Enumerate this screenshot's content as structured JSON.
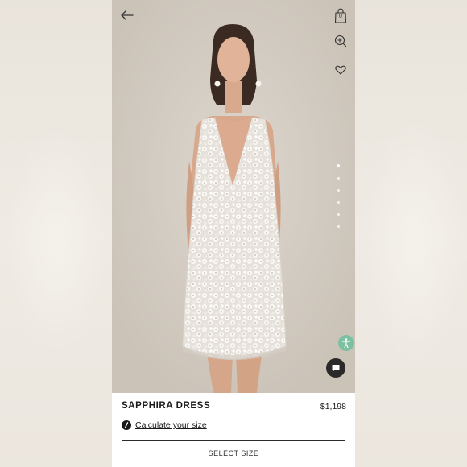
{
  "header": {
    "back_icon": "arrow-left-icon",
    "bag_icon": "shopping-bag-icon",
    "bag_count": "0",
    "zoom_icon": "zoom-in-icon",
    "wishlist_icon": "heart-icon"
  },
  "gallery": {
    "image_count": 6,
    "active_index": 0
  },
  "floating": {
    "accessibility_icon": "accessibility-icon",
    "chat_icon": "chat-icon",
    "accessibility_color": "#7bc1a1"
  },
  "product": {
    "name": "SAPPHIRA DRESS",
    "price": "$1,198",
    "size_calc_label": "Calculate your size",
    "select_size_label": "SELECT SIZE"
  }
}
